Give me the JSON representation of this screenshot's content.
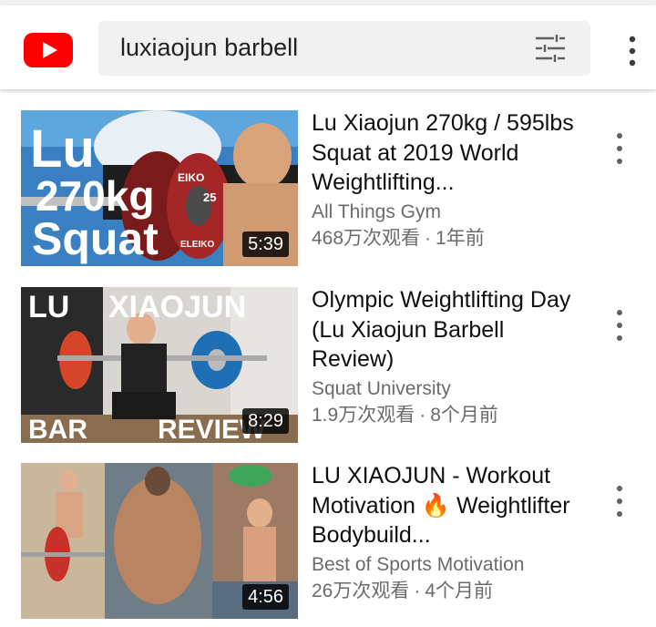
{
  "search": {
    "query": "luxiaojun barbell"
  },
  "icons": {
    "logo": "youtube-logo-icon",
    "filter": "filter-sliders-icon",
    "more": "more-vert-icon"
  },
  "colors": {
    "brand_red": "#ff0000",
    "text_primary": "#0f0f0f",
    "text_secondary": "#6b6b6b"
  },
  "results": [
    {
      "title": "Lu Xiaojun 270kg / 595lbs Squat at 2019 World Weightlifting...",
      "channel": "All Things Gym",
      "views": "468万次观看",
      "age": "1年前",
      "duration": "5:39",
      "thumb_text": [
        "Lu",
        "270kg",
        "Squat"
      ],
      "plate_text": [
        "EIKO",
        "25",
        "ELEIKO"
      ]
    },
    {
      "title": "Olympic Weightlifting Day (Lu Xiaojun Barbell Review)",
      "channel": "Squat University",
      "views": "1.9万次观看",
      "age": "8个月前",
      "duration": "8:29",
      "thumb_text": [
        "LU",
        "XIAOJUN",
        "BAR",
        "REVIEW"
      ]
    },
    {
      "title": "LU XIAOJUN - Workout Motivation 🔥 Weightlifter Bodybuild...",
      "channel": "Best of Sports Motivation",
      "views": "26万次观看",
      "age": "4个月前",
      "duration": "4:56"
    }
  ],
  "separator": "·"
}
